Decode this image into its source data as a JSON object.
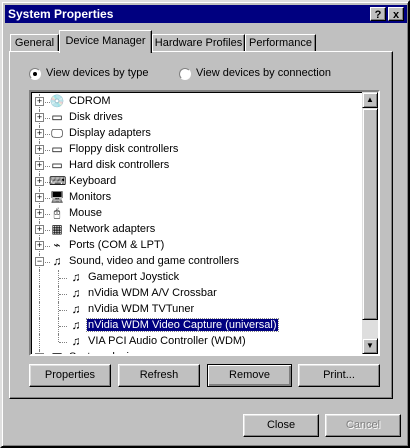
{
  "window": {
    "title": "System Properties",
    "help_label": "?",
    "close_label": "x"
  },
  "tabs": [
    {
      "label": "General"
    },
    {
      "label": "Device Manager"
    },
    {
      "label": "Hardware Profiles"
    },
    {
      "label": "Performance"
    }
  ],
  "view_options": {
    "by_type_label": "View devices by type",
    "by_connection_label": "View devices by connection",
    "selected": "by_type"
  },
  "tree": {
    "items": [
      {
        "label": "CDROM",
        "expanded": false,
        "icon": "cdrom-icon"
      },
      {
        "label": "Disk drives",
        "expanded": false,
        "icon": "disk-drive-icon"
      },
      {
        "label": "Display adapters",
        "expanded": false,
        "icon": "display-adapter-icon"
      },
      {
        "label": "Floppy disk controllers",
        "expanded": false,
        "icon": "floppy-controller-icon"
      },
      {
        "label": "Hard disk controllers",
        "expanded": false,
        "icon": "hard-disk-controller-icon"
      },
      {
        "label": "Keyboard",
        "expanded": false,
        "icon": "keyboard-icon"
      },
      {
        "label": "Monitors",
        "expanded": false,
        "icon": "monitor-icon"
      },
      {
        "label": "Mouse",
        "expanded": false,
        "icon": "mouse-icon"
      },
      {
        "label": "Network adapters",
        "expanded": false,
        "icon": "network-adapter-icon"
      },
      {
        "label": "Ports (COM & LPT)",
        "expanded": false,
        "icon": "port-icon"
      },
      {
        "label": "Sound, video and game controllers",
        "expanded": true,
        "icon": "sound-video-icon"
      },
      {
        "label": "Gameport Joystick",
        "child": true,
        "icon": "multimedia-device-icon"
      },
      {
        "label": "nVidia WDM A/V Crossbar",
        "child": true,
        "icon": "multimedia-device-icon"
      },
      {
        "label": "nVidia WDM TVTuner",
        "child": true,
        "icon": "multimedia-device-icon"
      },
      {
        "label": "nVidia WDM Video Capture (universal)",
        "child": true,
        "selected": true,
        "icon": "multimedia-device-icon"
      },
      {
        "label": "VIA PCI Audio Controller (WDM)",
        "child": true,
        "icon": "multimedia-device-icon"
      },
      {
        "label": "System devices",
        "expanded": false,
        "icon": "system-device-icon"
      }
    ]
  },
  "buttons": {
    "properties": "Properties",
    "refresh": "Refresh",
    "remove": "Remove",
    "print": "Print...",
    "close": "Close",
    "cancel": "Cancel"
  }
}
